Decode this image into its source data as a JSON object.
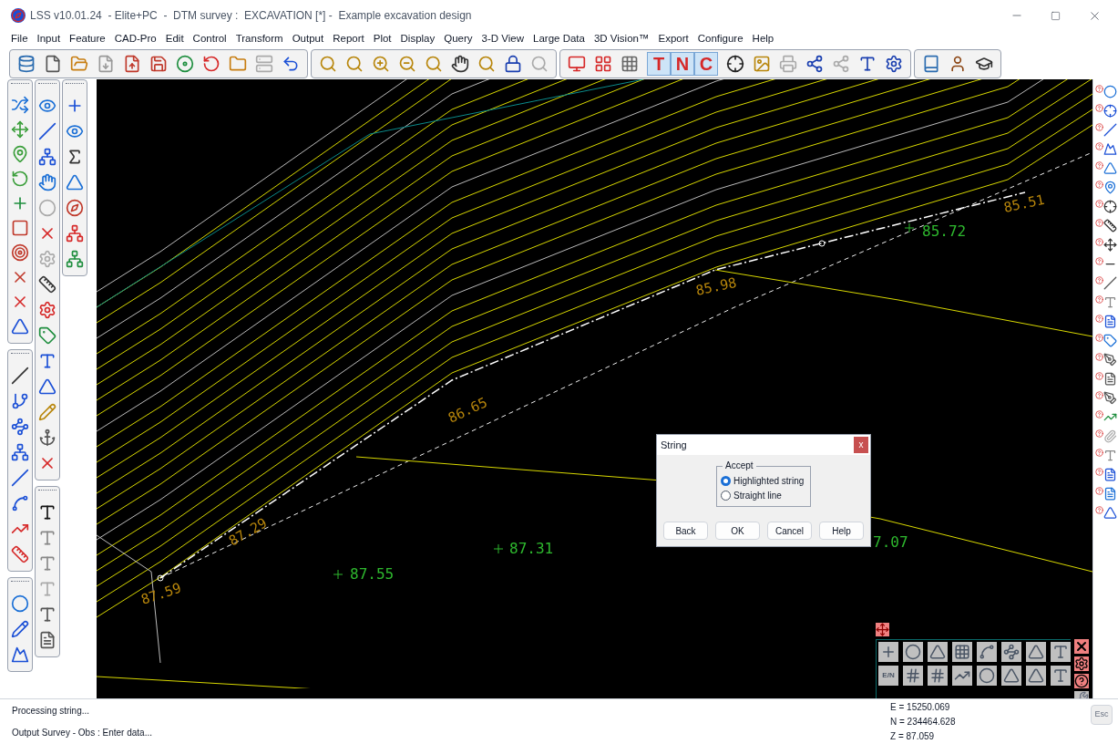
{
  "window": {
    "title": "LSS v10.01.24  - Elite+PC  -  DTM survey :  EXCAVATION [*] -  Example excavation design"
  },
  "menu": [
    "File",
    "Input",
    "Feature",
    "CAD-Pro",
    "Edit",
    "Control",
    "Transform",
    "Output",
    "Report",
    "Plot",
    "Display",
    "Query",
    "3-D View",
    "Large Data",
    "3D Vision™",
    "Export",
    "Configure",
    "Help"
  ],
  "toolbar": {
    "toggles": [
      {
        "label": "T",
        "selected": true
      },
      {
        "label": "N",
        "selected": true
      },
      {
        "label": "C",
        "selected": true
      }
    ]
  },
  "canvas": {
    "labels": [
      {
        "text": "85.51",
        "kind": "contour"
      },
      {
        "text": "85.72",
        "kind": "spot"
      },
      {
        "text": "85.98",
        "kind": "contour"
      },
      {
        "text": "86.65",
        "kind": "contour"
      },
      {
        "text": "87.29",
        "kind": "contour"
      },
      {
        "text": "87.31",
        "kind": "spot"
      },
      {
        "text": "7.07",
        "kind": "spot"
      },
      {
        "text": "87.55",
        "kind": "spot"
      },
      {
        "text": "87.59",
        "kind": "contour"
      }
    ]
  },
  "dialog": {
    "title": "String",
    "close": "x",
    "group": "Accept",
    "options": [
      {
        "label": "Highlighted string",
        "selected": true
      },
      {
        "label": "Straight line",
        "selected": false
      }
    ],
    "buttons": [
      "Back",
      "OK",
      "Cancel",
      "Help"
    ]
  },
  "toolbox": {
    "label": "E/N"
  },
  "status": {
    "messages": [
      "Processing string...",
      "Output Survey - Obs : Enter data..."
    ],
    "coords": [
      "E = 15250.069",
      "N = 234464.628",
      "Z = 87.059"
    ],
    "esc": {
      "label": "Esc",
      "disabled": true
    }
  }
}
